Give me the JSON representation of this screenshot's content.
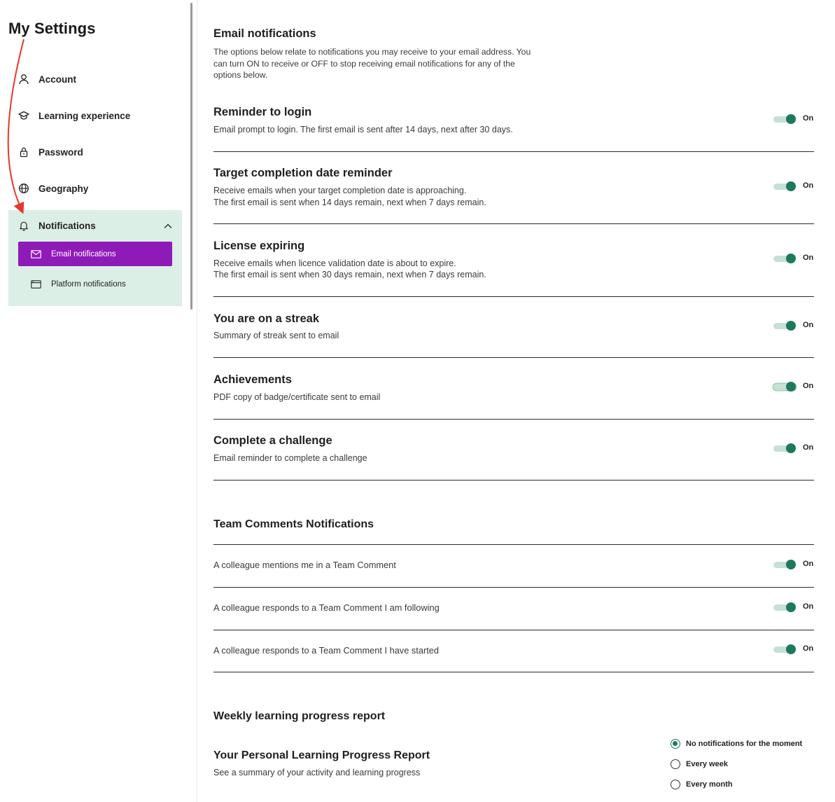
{
  "sidebar": {
    "title": "My Settings",
    "items": [
      {
        "label": "Account",
        "icon": "user-icon"
      },
      {
        "label": "Learning experience",
        "icon": "graduation-cap-icon"
      },
      {
        "label": "Password",
        "icon": "lock-icon"
      },
      {
        "label": "Geography",
        "icon": "globe-icon"
      }
    ],
    "notifications": {
      "label": "Notifications",
      "icon": "bell-icon",
      "expanded": true,
      "sub_items": [
        {
          "label": "Email notifications",
          "icon": "envelope-icon",
          "active": true
        },
        {
          "label": "Platform notifications",
          "icon": "browser-window-icon",
          "active": false
        }
      ]
    }
  },
  "colors": {
    "accent_purple": "#8e1ab8",
    "panel_green": "#dcefe7",
    "toggle_green": "#1c7a5a",
    "annotation_red": "#e8372b"
  },
  "email": {
    "title": "Email notifications",
    "intro": "The options below relate to notifications you may receive to your email address. You can turn ON to receive or OFF to stop receiving email notifications for any of the options below.",
    "settings": [
      {
        "title": "Reminder to login",
        "desc1": "Email prompt to login. The first email is sent after 14 days, next after 30 days.",
        "desc2": "",
        "state": "On"
      },
      {
        "title": "Target completion date reminder",
        "desc1": "Receive emails when your target completion date is approaching.",
        "desc2": "The first email is sent when 14 days remain, next when 7 days remain.",
        "state": "On"
      },
      {
        "title": "License expiring",
        "desc1": "Receive emails when licence validation date is about to expire.",
        "desc2": "The first email is sent when 30 days remain, next when 7 days remain.",
        "state": "On"
      },
      {
        "title": "You are on a streak",
        "desc1": "Summary of streak sent to email",
        "desc2": "",
        "state": "On"
      },
      {
        "title": "Achievements",
        "desc1": "PDF copy of badge/certificate sent to email",
        "desc2": "",
        "state": "On"
      },
      {
        "title": "Complete a challenge",
        "desc1": "Email reminder to complete a challenge",
        "desc2": "",
        "state": "On"
      }
    ]
  },
  "team": {
    "title": "Team Comments Notifications",
    "rows": [
      {
        "desc": "A colleague mentions me in a Team Comment",
        "state": "On"
      },
      {
        "desc": "A colleague responds to a Team Comment I am following",
        "state": "On"
      },
      {
        "desc": "A colleague responds to a Team Comment I have started",
        "state": "On"
      }
    ]
  },
  "weekly": {
    "title": "Weekly learning progress report",
    "report_title": "Your Personal Learning Progress Report",
    "report_desc": "See a summary of your activity and learning progress",
    "options": [
      {
        "label": "No notifications for the moment",
        "checked": true
      },
      {
        "label": "Every week",
        "checked": false
      },
      {
        "label": "Every month",
        "checked": false
      }
    ]
  }
}
